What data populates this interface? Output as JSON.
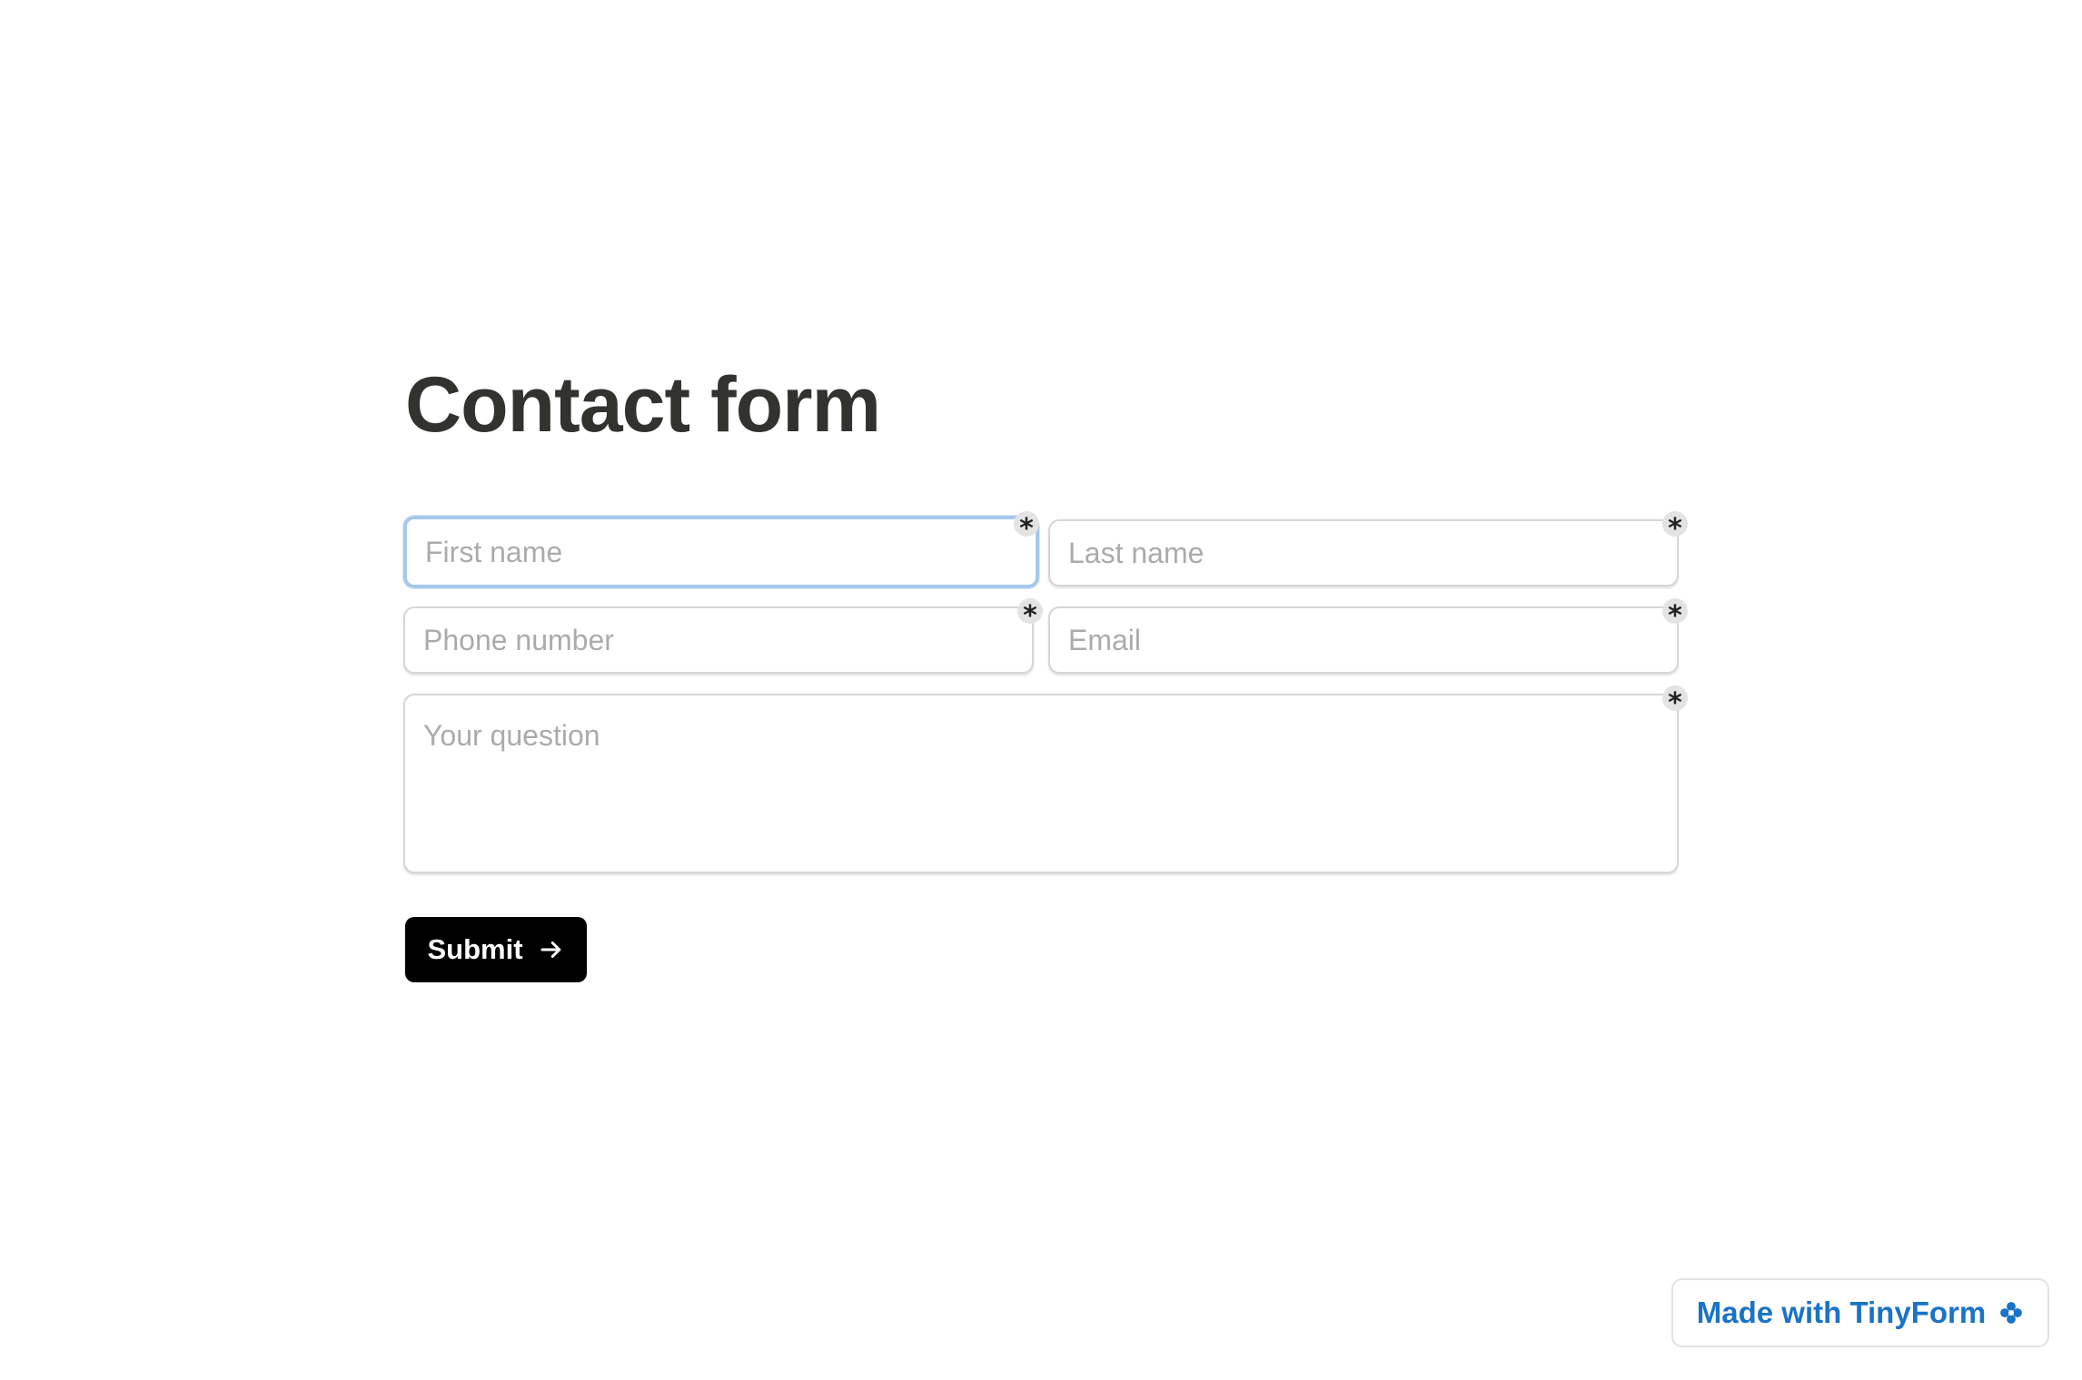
{
  "form": {
    "title": "Contact form",
    "fields": {
      "first_name": {
        "placeholder": "First name",
        "value": "",
        "required_mark": "*"
      },
      "last_name": {
        "placeholder": "Last name",
        "value": "",
        "required_mark": "*"
      },
      "phone": {
        "placeholder": "Phone number",
        "value": "",
        "required_mark": "*"
      },
      "email": {
        "placeholder": "Email",
        "value": "",
        "required_mark": "*"
      },
      "question": {
        "placeholder": "Your question",
        "value": "",
        "required_mark": "*"
      }
    },
    "submit_label": "Submit",
    "submit_icon": "arrow-right-icon"
  },
  "badge": {
    "label": "Made with TinyForm",
    "icon": "flower-icon"
  },
  "colors": {
    "title": "#32332f",
    "button_bg": "#000000",
    "button_text": "#ffffff",
    "focus_ring": "#a6c8ec",
    "field_border": "#d6d6d6",
    "placeholder": "#ababab",
    "badge_text": "#1a73c6"
  }
}
